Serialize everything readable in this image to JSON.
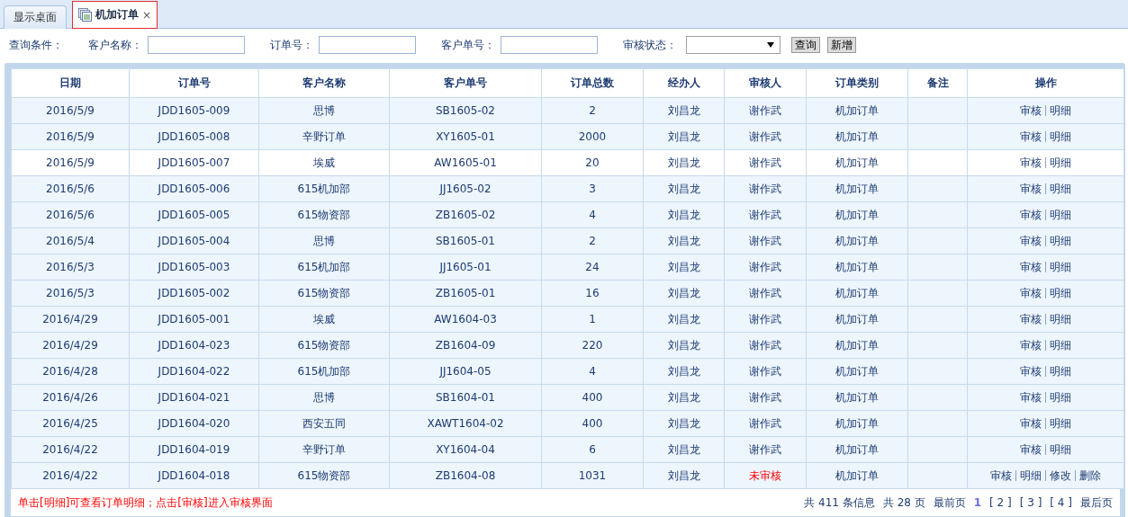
{
  "tabs": [
    {
      "label": "显示桌面",
      "selected": false
    },
    {
      "label": "机加订单",
      "selected": true,
      "close": "×"
    }
  ],
  "filter": {
    "title": "查询条件：",
    "fields": [
      {
        "label": "客户名称：",
        "kind": "text"
      },
      {
        "label": "订单号：",
        "kind": "text"
      },
      {
        "label": "客户单号：",
        "kind": "text"
      },
      {
        "label": "审核状态：",
        "kind": "select"
      }
    ],
    "buttons": [
      "查询",
      "新增"
    ]
  },
  "table": {
    "columns": [
      "日期",
      "订单号",
      "客户名称",
      "客户单号",
      "订单总数",
      "经办人",
      "审核人",
      "订单类别",
      "备注",
      "操作"
    ],
    "rows": [
      {
        "cells": [
          "2016/5/9",
          "JDD1605-009",
          "思博",
          "SB1605-02",
          "2",
          "刘昌龙",
          "谢作武",
          "机加订单",
          ""
        ],
        "approved": true,
        "selected": false,
        "actions": [
          "审核",
          "明细"
        ]
      },
      {
        "cells": [
          "2016/5/9",
          "JDD1605-008",
          "辛野订单",
          "XY1605-01",
          "2000",
          "刘昌龙",
          "谢作武",
          "机加订单",
          ""
        ],
        "approved": true,
        "selected": false,
        "actions": [
          "审核",
          "明细"
        ]
      },
      {
        "cells": [
          "2016/5/9",
          "JDD1605-007",
          "埃威",
          "AW1605-01",
          "20",
          "刘昌龙",
          "谢作武",
          "机加订单",
          ""
        ],
        "approved": true,
        "selected": true,
        "actions": [
          "审核",
          "明细"
        ]
      },
      {
        "cells": [
          "2016/5/6",
          "JDD1605-006",
          "615机加部",
          "JJ1605-02",
          "3",
          "刘昌龙",
          "谢作武",
          "机加订单",
          ""
        ],
        "approved": true,
        "selected": false,
        "actions": [
          "审核",
          "明细"
        ]
      },
      {
        "cells": [
          "2016/5/6",
          "JDD1605-005",
          "615物资部",
          "ZB1605-02",
          "4",
          "刘昌龙",
          "谢作武",
          "机加订单",
          ""
        ],
        "approved": true,
        "selected": false,
        "actions": [
          "审核",
          "明细"
        ]
      },
      {
        "cells": [
          "2016/5/4",
          "JDD1605-004",
          "思博",
          "SB1605-01",
          "2",
          "刘昌龙",
          "谢作武",
          "机加订单",
          ""
        ],
        "approved": true,
        "selected": false,
        "actions": [
          "审核",
          "明细"
        ]
      },
      {
        "cells": [
          "2016/5/3",
          "JDD1605-003",
          "615机加部",
          "JJ1605-01",
          "24",
          "刘昌龙",
          "谢作武",
          "机加订单",
          ""
        ],
        "approved": true,
        "selected": false,
        "actions": [
          "审核",
          "明细"
        ]
      },
      {
        "cells": [
          "2016/5/3",
          "JDD1605-002",
          "615物资部",
          "ZB1605-01",
          "16",
          "刘昌龙",
          "谢作武",
          "机加订单",
          ""
        ],
        "approved": true,
        "selected": false,
        "actions": [
          "审核",
          "明细"
        ]
      },
      {
        "cells": [
          "2016/4/29",
          "JDD1605-001",
          "埃威",
          "AW1604-03",
          "1",
          "刘昌龙",
          "谢作武",
          "机加订单",
          ""
        ],
        "approved": true,
        "selected": false,
        "actions": [
          "审核",
          "明细"
        ]
      },
      {
        "cells": [
          "2016/4/29",
          "JDD1604-023",
          "615物资部",
          "ZB1604-09",
          "220",
          "刘昌龙",
          "谢作武",
          "机加订单",
          ""
        ],
        "approved": true,
        "selected": false,
        "actions": [
          "审核",
          "明细"
        ]
      },
      {
        "cells": [
          "2016/4/28",
          "JDD1604-022",
          "615机加部",
          "JJ1604-05",
          "4",
          "刘昌龙",
          "谢作武",
          "机加订单",
          ""
        ],
        "approved": true,
        "selected": false,
        "actions": [
          "审核",
          "明细"
        ]
      },
      {
        "cells": [
          "2016/4/26",
          "JDD1604-021",
          "思博",
          "SB1604-01",
          "400",
          "刘昌龙",
          "谢作武",
          "机加订单",
          ""
        ],
        "approved": true,
        "selected": false,
        "actions": [
          "审核",
          "明细"
        ]
      },
      {
        "cells": [
          "2016/4/25",
          "JDD1604-020",
          "西安五同",
          "XAWT1604-02",
          "400",
          "刘昌龙",
          "谢作武",
          "机加订单",
          ""
        ],
        "approved": true,
        "selected": false,
        "actions": [
          "审核",
          "明细"
        ]
      },
      {
        "cells": [
          "2016/4/22",
          "JDD1604-019",
          "辛野订单",
          "XY1604-04",
          "6",
          "刘昌龙",
          "谢作武",
          "机加订单",
          ""
        ],
        "approved": true,
        "selected": false,
        "actions": [
          "审核",
          "明细"
        ]
      },
      {
        "cells": [
          "2016/4/22",
          "JDD1604-018",
          "615物资部",
          "ZB1604-08",
          "1031",
          "刘昌龙",
          "未审核",
          "机加订单",
          ""
        ],
        "approved": false,
        "selected": false,
        "actions": [
          "审核",
          "明细",
          "修改",
          "删除"
        ]
      }
    ]
  },
  "hint": "单击[明细]可查看订单明细；点击[审核]进入审核界面",
  "pager": {
    "total": "共 411 条信息",
    "pages": "共 28 页",
    "first": "最前页",
    "items": [
      {
        "label": "1",
        "selected": true
      },
      {
        "label": "[ 2 ]",
        "selected": false
      },
      {
        "label": "[ 3 ]",
        "selected": false
      },
      {
        "label": "[ 4 ]",
        "selected": false
      }
    ],
    "last": "最后页"
  }
}
